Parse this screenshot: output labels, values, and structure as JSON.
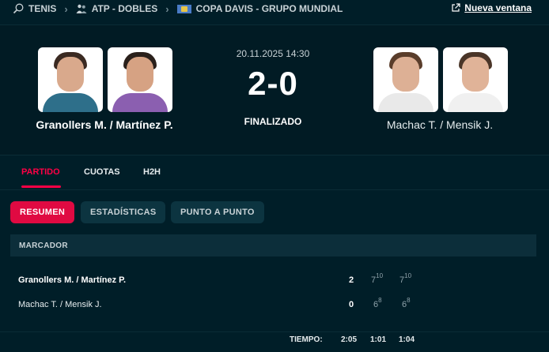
{
  "breadcrumb": {
    "sport": "TENIS",
    "category": "ATP - DOBLES",
    "tournament": "COPA DAVIS - GRUPO MUNDIAL",
    "new_window": "Nueva ventana"
  },
  "match": {
    "datetime": "20.11.2025 14:30",
    "score": "2-0",
    "status": "FINALIZADO",
    "home": "Granollers M. / Martínez P.",
    "away": "Machac T. / Mensik J."
  },
  "tabs": [
    "PARTIDO",
    "CUOTAS",
    "H2H"
  ],
  "subtabs": [
    "RESUMEN",
    "ESTADÍSTICAS",
    "PUNTO A PUNTO"
  ],
  "scoreboard": {
    "header": "MARCADOR",
    "rows": [
      {
        "name": "Granollers M. / Martínez P.",
        "total": "2",
        "sets": [
          {
            "g": "7",
            "tb": "10"
          },
          {
            "g": "7",
            "tb": "10"
          }
        ]
      },
      {
        "name": "Machac T. / Mensik J.",
        "total": "0",
        "sets": [
          {
            "g": "6",
            "tb": "8"
          },
          {
            "g": "6",
            "tb": "8"
          }
        ]
      }
    ],
    "time_label": "TIEMPO:",
    "times": [
      "2:05",
      "1:01",
      "1:04"
    ]
  },
  "colors": {
    "accent": "#ff0046",
    "background": "#001e28",
    "pill": "#0c3440"
  },
  "icons": [
    "tennis-racket-icon",
    "chevron-right-icon",
    "doubles-players-icon",
    "davis-cup-flag-icon",
    "external-link-icon"
  ]
}
